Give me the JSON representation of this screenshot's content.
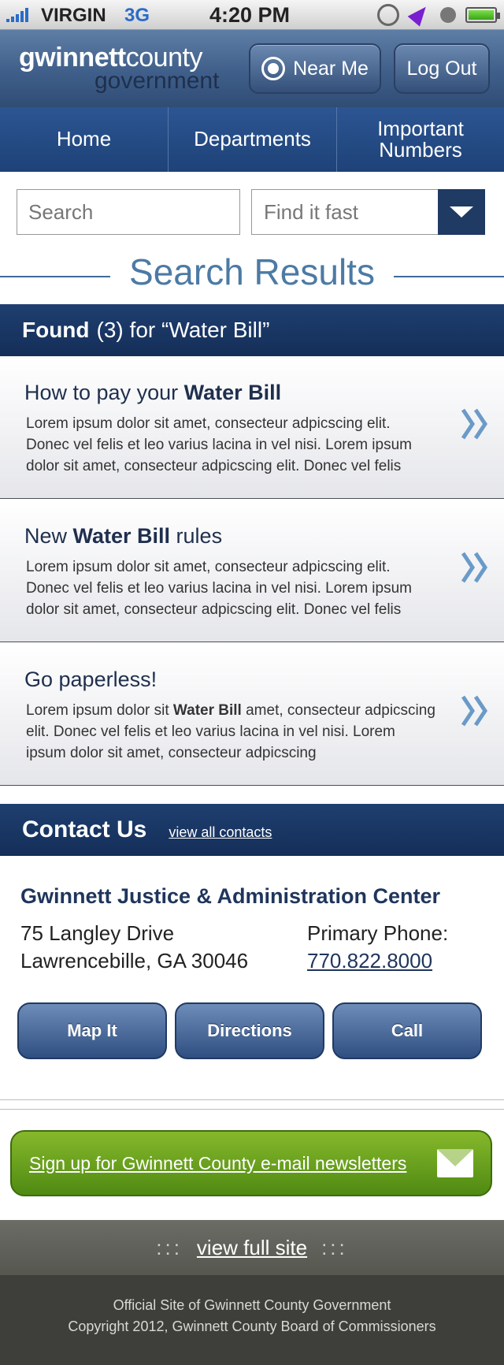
{
  "status_bar": {
    "carrier": "VIRGIN",
    "network": "3G",
    "time": "4:20 PM"
  },
  "header": {
    "logo_top_bold": "gwinnett",
    "logo_top_light": "county",
    "logo_bottom": "government",
    "near_me_label": "Near Me",
    "logout_label": "Log Out"
  },
  "nav": {
    "items": [
      {
        "label": "Home"
      },
      {
        "label": "Departments"
      },
      {
        "label": "Important Numbers"
      }
    ]
  },
  "search": {
    "placeholder": "Search",
    "find_fast_label": "Find it fast"
  },
  "results": {
    "title": "Search Results",
    "found_label": "Found",
    "found_count": "(3)",
    "found_query": "for “Water Bill”",
    "items": [
      {
        "title_pre": "How to pay your ",
        "title_bold": "Water Bill",
        "title_post": "",
        "desc_pre": "Lorem ipsum dolor sit amet, consecteur adpicscing elit. Donec vel felis et leo varius lacina in vel nisi. Lorem ipsum dolor sit amet, consecteur adpicscing elit. Donec vel felis",
        "desc_bold": "",
        "desc_post": ""
      },
      {
        "title_pre": "New ",
        "title_bold": "Water Bill",
        "title_post": " rules",
        "desc_pre": "Lorem ipsum dolor sit amet, consecteur adpicscing elit. Donec vel felis et leo varius lacina in vel nisi. Lorem ipsum dolor sit amet, consecteur adpicscing elit. Donec vel felis",
        "desc_bold": "",
        "desc_post": ""
      },
      {
        "title_pre": "Go paperless!",
        "title_bold": "",
        "title_post": "",
        "desc_pre": "Lorem ipsum dolor sit ",
        "desc_bold": "Water Bill",
        "desc_post": " amet, consecteur adpicscing elit. Donec vel felis et leo varius lacina in vel nisi. Lorem ipsum dolor sit amet, consecteur adpicscing"
      }
    ]
  },
  "contact": {
    "title": "Contact Us",
    "view_all_label": "view all contacts",
    "org_name": "Gwinnett Justice & Administration Center",
    "address_line1": "75 Langley Drive",
    "address_line2": "Lawrencebille, GA 30046",
    "phone_label": "Primary Phone:",
    "phone_number": "770.822.8000",
    "buttons": {
      "map": "Map It",
      "directions": "Directions",
      "call": "Call"
    }
  },
  "newsletter": {
    "label": "Sign up for Gwinnett County e-mail newsletters"
  },
  "full_site": {
    "dots": ":::",
    "label": "view full site"
  },
  "footer": {
    "line1": "Official Site of Gwinnett County Government",
    "line2": "Copyright 2012, Gwinnett County Board of Commissioners"
  },
  "colors": {
    "brand_navy": "#1f3f70",
    "accent_blue": "#4c7aa4",
    "newsletter_green": "#6aa21f",
    "footer_dark": "#3e3f3a"
  }
}
